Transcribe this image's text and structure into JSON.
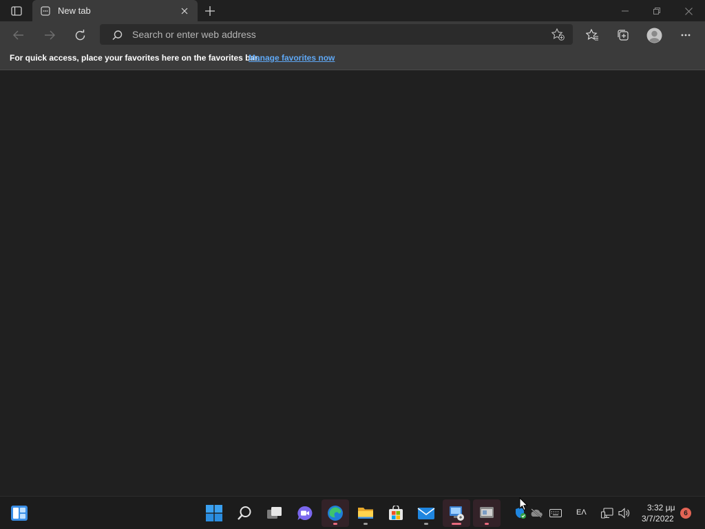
{
  "browser": {
    "tab": {
      "title": "New tab"
    },
    "address_bar": {
      "placeholder": "Search or enter web address",
      "value": ""
    },
    "favorites_bar": {
      "message": "For quick access, place your favorites here on the favorites bar.",
      "link": "Manage favorites now"
    },
    "icons": [
      "tab-actions-icon",
      "new-tab-page-icon",
      "close-tab-icon",
      "new-tab-icon",
      "minimize-icon",
      "restore-icon",
      "close-icon",
      "back-icon",
      "forward-icon",
      "refresh-icon",
      "search-icon",
      "add-favorite-icon",
      "favorites-icon",
      "collections-icon",
      "profile-icon",
      "more-icon"
    ]
  },
  "taskbar": {
    "apps": [
      {
        "name": "widgets"
      },
      {
        "name": "start"
      },
      {
        "name": "search"
      },
      {
        "name": "task-view"
      },
      {
        "name": "chat"
      },
      {
        "name": "edge",
        "running": true
      },
      {
        "name": "file-explorer",
        "running": true
      },
      {
        "name": "microsoft-store"
      },
      {
        "name": "mail",
        "running": true
      },
      {
        "name": "remote-desktop",
        "running": true,
        "active": true
      },
      {
        "name": "app-window",
        "running": true,
        "active": true
      }
    ],
    "tray": {
      "language": "EΛ",
      "time": "3:32 μμ",
      "date": "3/7/2022",
      "notification_count": "6"
    }
  },
  "colors": {
    "accent": "#5fa8f5",
    "background": "#202020",
    "toolbar": "#3b3b3b",
    "badge": "#e36455"
  }
}
